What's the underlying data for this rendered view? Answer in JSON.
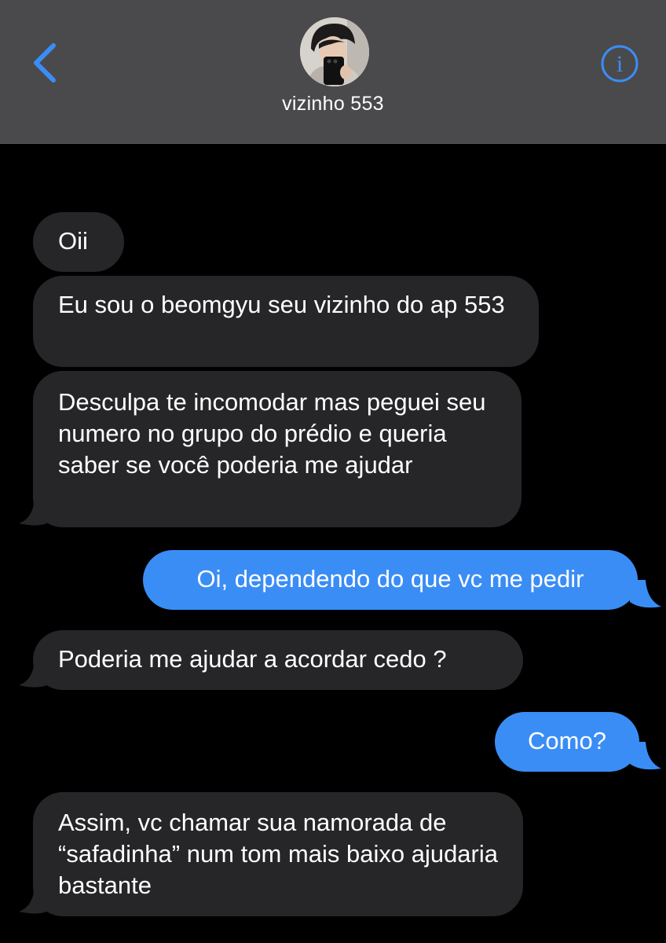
{
  "header": {
    "contact_name": "vizinho 553",
    "back_icon": "chevron-left-icon",
    "info_icon": "info-icon",
    "avatar_icon": "contact-avatar-photo",
    "background_color": "#4a4a4c",
    "accent_color": "#3a8df5"
  },
  "messages": [
    {
      "direction": "incoming",
      "text": "Oii"
    },
    {
      "direction": "incoming",
      "text": "Eu sou o beomgyu seu vizinho do ap 553"
    },
    {
      "direction": "incoming",
      "text": "Desculpa te incomodar mas peguei seu numero no grupo do prédio e queria saber se você poderia me ajudar"
    },
    {
      "direction": "outgoing",
      "text": "Oi, dependendo do que vc me pedir"
    },
    {
      "direction": "incoming",
      "text": "Poderia me ajudar a acordar cedo ?"
    },
    {
      "direction": "outgoing",
      "text": "Como?"
    },
    {
      "direction": "incoming",
      "text": "Assim, vc chamar sua namorada de “safadinha” num tom mais baixo ajudaria bastante"
    }
  ],
  "colors": {
    "incoming_bubble": "#262628",
    "outgoing_bubble": "#3a8df5",
    "background": "#000000"
  }
}
